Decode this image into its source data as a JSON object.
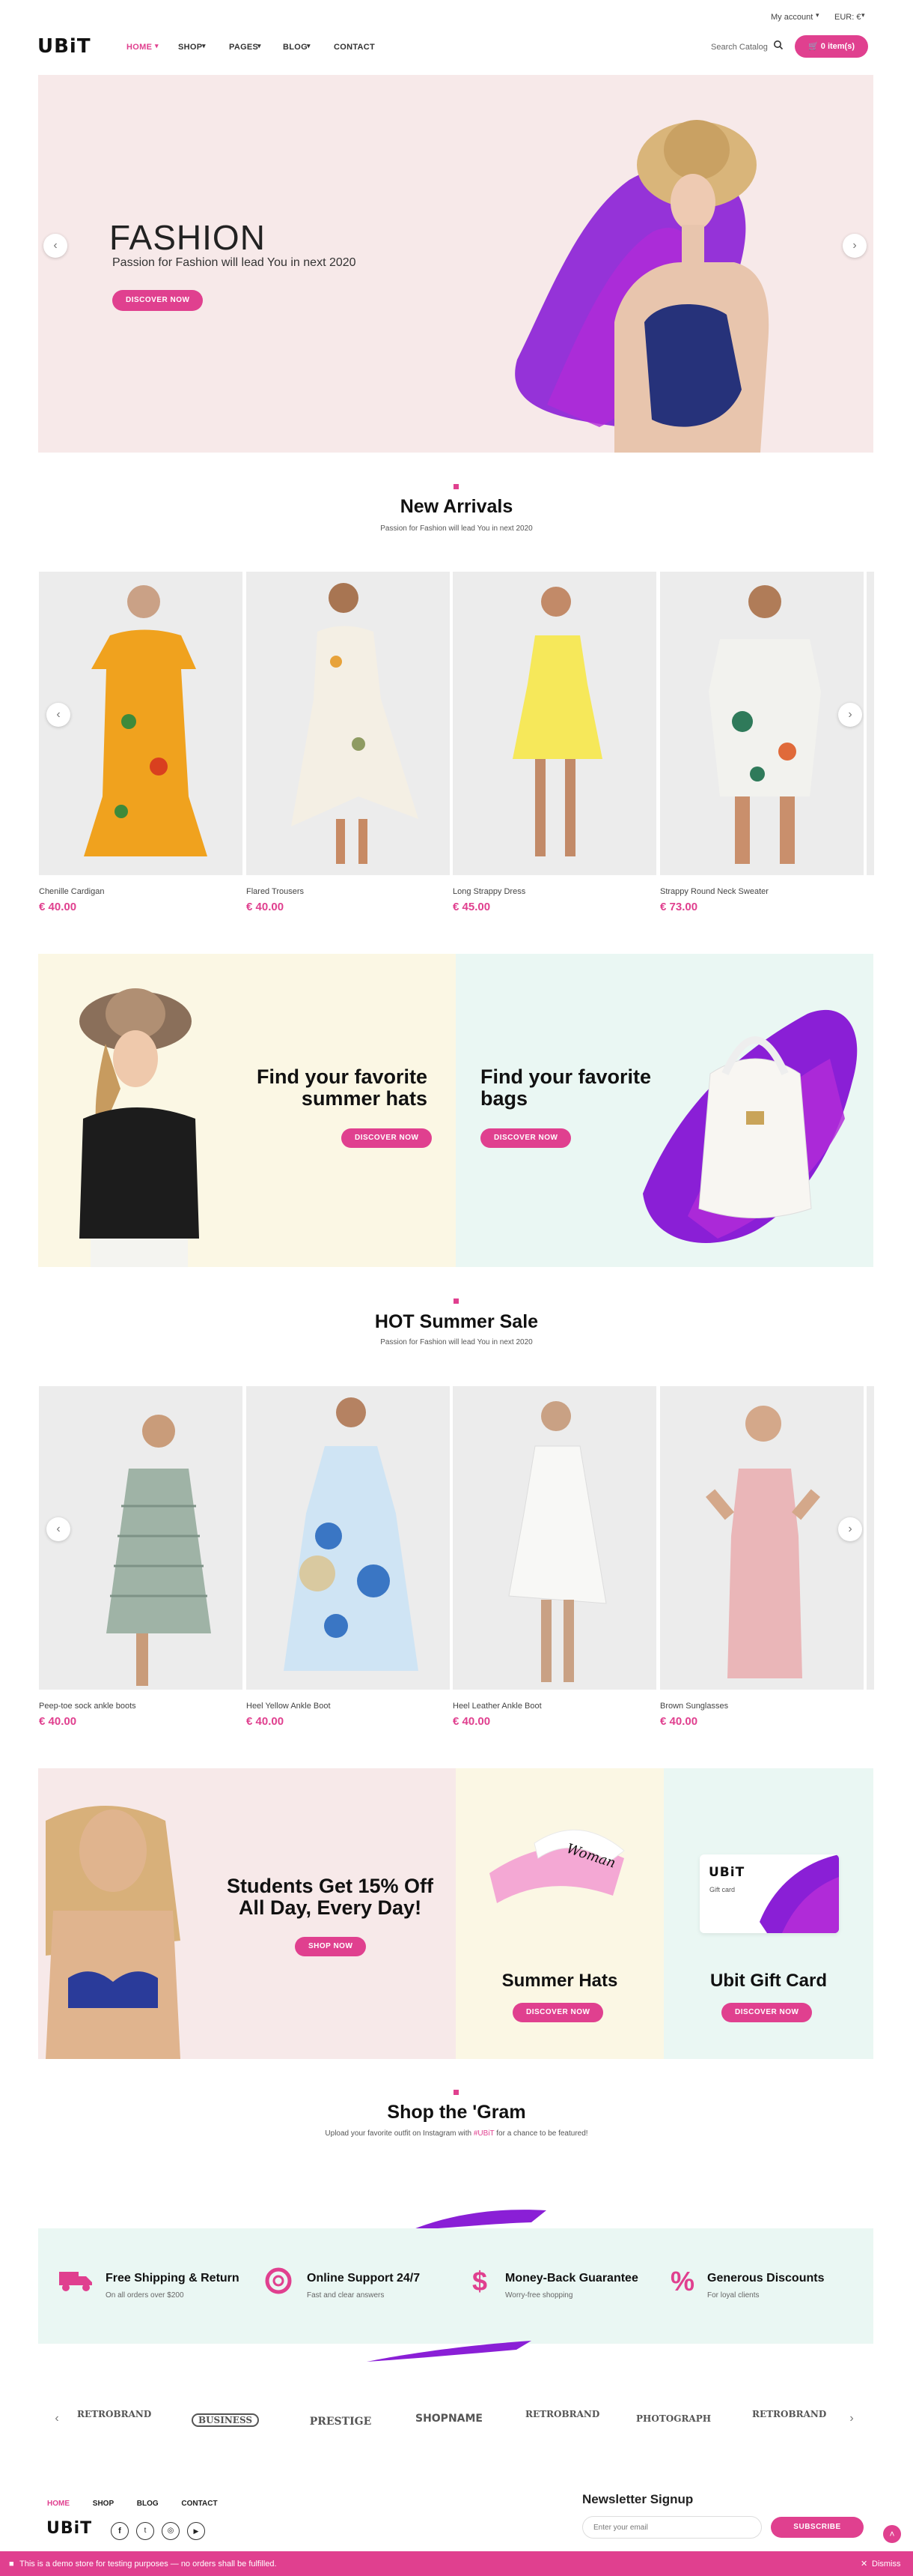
{
  "topbar": {
    "account": "My account",
    "currency": "EUR: €"
  },
  "header": {
    "logo": "UBiT",
    "search_placeholder": "Search Catalog",
    "cart_label": "0 item(s)"
  },
  "nav": [
    {
      "label": "HOME"
    },
    {
      "label": "SHOP"
    },
    {
      "label": "PAGES"
    },
    {
      "label": "BLOG"
    },
    {
      "label": "CONTACT"
    }
  ],
  "hero": {
    "title": "FASHION",
    "subtitle": "Passion for Fashion will lead You in next 2020",
    "button": "DISCOVER NOW"
  },
  "new_arrivals": {
    "title": "New Arrivals",
    "subtitle": "Passion for Fashion will lead You in next 2020",
    "products": [
      {
        "name": "Chenille Cardigan",
        "price": "€ 40.00"
      },
      {
        "name": "Flared Trousers",
        "price": "€ 40.00"
      },
      {
        "name": "Long Strappy Dress",
        "price": "€ 45.00"
      },
      {
        "name": "Strappy Round Neck Sweater",
        "price": "€ 73.00"
      }
    ]
  },
  "promo": {
    "hats_title": "Find your favorite summer hats",
    "hats_button": "DISCOVER NOW",
    "bags_title": "Find your favorite bags",
    "bags_button": "DISCOVER NOW"
  },
  "hot_sale": {
    "title": "HOT Summer Sale",
    "subtitle": "Passion for Fashion will lead You in next 2020",
    "products": [
      {
        "name": "Peep-toe sock ankle boots",
        "price": "€ 40.00"
      },
      {
        "name": "Heel Yellow Ankle Boot",
        "price": "€ 40.00"
      },
      {
        "name": "Heel Leather Ankle Boot",
        "price": "€ 40.00"
      },
      {
        "name": "Brown Sunglasses",
        "price": "€ 40.00"
      }
    ]
  },
  "students": {
    "title": "Students Get 15% Off All Day, Every Day!",
    "button": "SHOP NOW",
    "visor_text": "Woman"
  },
  "summer_hats": {
    "title": "Summer Hats",
    "button": "DISCOVER NOW"
  },
  "gift_card": {
    "title": "Ubit Gift Card",
    "button": "DISCOVER NOW",
    "card_logo": "UBiT",
    "card_label": "Gift card"
  },
  "gram": {
    "title": "Shop the 'Gram",
    "sub_before": "Upload your favorite outfit on Instagram with ",
    "hashtag": "#UBiT",
    "sub_after": " for a chance to be featured!"
  },
  "features": [
    {
      "icon": "truck-icon",
      "title": "Free Shipping & Return",
      "sub": "On all orders over $200"
    },
    {
      "icon": "lifebuoy-icon",
      "title": "Online Support 24/7",
      "sub": "Fast and clear answers"
    },
    {
      "icon": "dollar-icon",
      "title": "Money-Back Guarantee",
      "sub": "Worry-free shopping"
    },
    {
      "icon": "percent-icon",
      "title": "Generous Discounts",
      "sub": "For loyal clients"
    }
  ],
  "brands": [
    {
      "label": "RETROBRAND"
    },
    {
      "label": "BUSINESS"
    },
    {
      "label": "PRESTIGE"
    },
    {
      "label": "SHOPNAME"
    },
    {
      "label": "RETROBRAND"
    },
    {
      "label": "PHOTOGRAPH"
    },
    {
      "label": "RETROBRAND"
    }
  ],
  "footer": {
    "links": [
      {
        "label": "HOME"
      },
      {
        "label": "SHOP"
      },
      {
        "label": "BLOG"
      },
      {
        "label": "CONTACT"
      }
    ],
    "logo": "UBiT",
    "newsletter_title": "Newsletter Signup",
    "email_placeholder": "Enter your email",
    "subscribe": "SUBSCRIBE"
  },
  "demo_notice": {
    "text": "This is a demo store for testing purposes — no orders shall be fulfilled.",
    "dismiss": "Dismiss"
  },
  "colors": {
    "accent": "#e0408f",
    "purple": "#8a1fd6",
    "hero_bg": "#f7e9e9",
    "cream": "#fbf7e4",
    "mint": "#eaf7f3"
  }
}
